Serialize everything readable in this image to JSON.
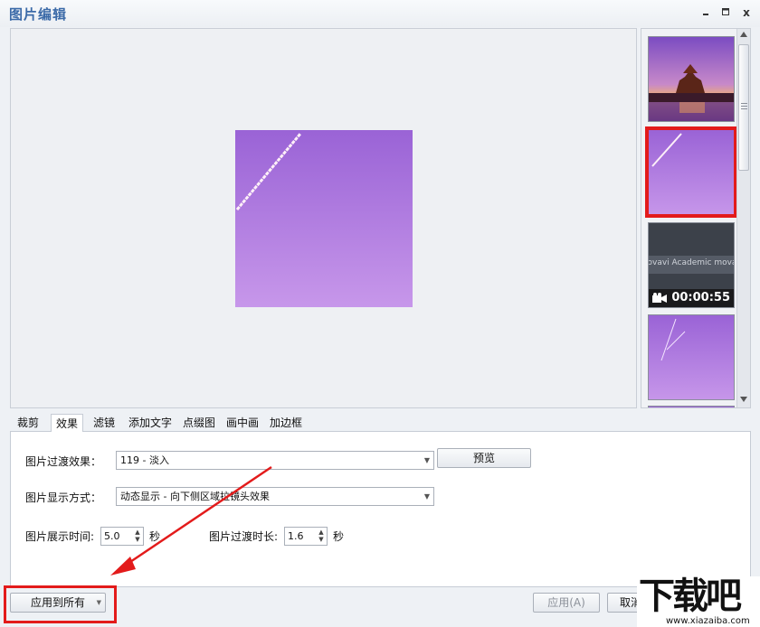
{
  "window": {
    "title": "图片编辑",
    "controls": {
      "close": "x"
    }
  },
  "thumbnails": [
    {
      "kind": "photo",
      "subject": "pagoda-sunset",
      "selected": false
    },
    {
      "kind": "photo",
      "subject": "purple-sky-streak",
      "selected": true
    },
    {
      "kind": "video",
      "overlay_text": "Movavi Academic movavi",
      "duration": "00:00:55",
      "selected": false
    },
    {
      "kind": "photo",
      "subject": "purple-sky-streak-2",
      "selected": false
    }
  ],
  "tabs": [
    {
      "label": "裁剪",
      "active": false
    },
    {
      "label": "效果",
      "active": true
    },
    {
      "label": "滤镜",
      "active": false
    },
    {
      "label": "添加文字",
      "active": false
    },
    {
      "label": "点缀图",
      "active": false
    },
    {
      "label": "画中画",
      "active": false
    },
    {
      "label": "加边框",
      "active": false
    }
  ],
  "effects": {
    "transition_label": "图片过渡效果：",
    "transition_value": "119 - 淡入",
    "preview_button": "预览",
    "display_label": "图片显示方式：",
    "display_value": "动态显示 - 向下侧区域拉镜头效果",
    "show_time_label": "图片展示时间:",
    "show_time_value": "5.0",
    "show_time_unit": "秒",
    "transition_time_label": "图片过渡时长:",
    "transition_time_value": "1.6",
    "transition_time_unit": "秒"
  },
  "footer": {
    "apply_all_button": "应用到所有",
    "apply_button": "应用(A)",
    "cancel_button": "取消"
  },
  "watermark": {
    "brand": "下载吧",
    "url": "www.xiazaiba.com"
  },
  "colors": {
    "title": "#3b6aa8",
    "highlight": "#e31b1b",
    "sky_top": "#9a63d6",
    "sky_bottom": "#c797ea"
  }
}
